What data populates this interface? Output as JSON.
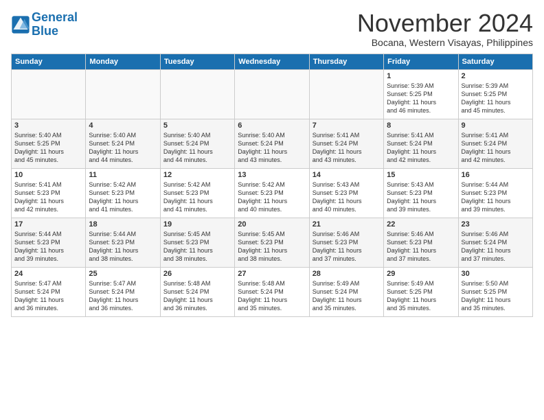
{
  "logo": {
    "text_general": "General",
    "text_blue": "Blue"
  },
  "title": "November 2024",
  "location": "Bocana, Western Visayas, Philippines",
  "weekdays": [
    "Sunday",
    "Monday",
    "Tuesday",
    "Wednesday",
    "Thursday",
    "Friday",
    "Saturday"
  ],
  "weeks": [
    [
      {
        "day": "",
        "info": ""
      },
      {
        "day": "",
        "info": ""
      },
      {
        "day": "",
        "info": ""
      },
      {
        "day": "",
        "info": ""
      },
      {
        "day": "",
        "info": ""
      },
      {
        "day": "1",
        "info": "Sunrise: 5:39 AM\nSunset: 5:25 PM\nDaylight: 11 hours\nand 46 minutes."
      },
      {
        "day": "2",
        "info": "Sunrise: 5:39 AM\nSunset: 5:25 PM\nDaylight: 11 hours\nand 45 minutes."
      }
    ],
    [
      {
        "day": "3",
        "info": "Sunrise: 5:40 AM\nSunset: 5:25 PM\nDaylight: 11 hours\nand 45 minutes."
      },
      {
        "day": "4",
        "info": "Sunrise: 5:40 AM\nSunset: 5:24 PM\nDaylight: 11 hours\nand 44 minutes."
      },
      {
        "day": "5",
        "info": "Sunrise: 5:40 AM\nSunset: 5:24 PM\nDaylight: 11 hours\nand 44 minutes."
      },
      {
        "day": "6",
        "info": "Sunrise: 5:40 AM\nSunset: 5:24 PM\nDaylight: 11 hours\nand 43 minutes."
      },
      {
        "day": "7",
        "info": "Sunrise: 5:41 AM\nSunset: 5:24 PM\nDaylight: 11 hours\nand 43 minutes."
      },
      {
        "day": "8",
        "info": "Sunrise: 5:41 AM\nSunset: 5:24 PM\nDaylight: 11 hours\nand 42 minutes."
      },
      {
        "day": "9",
        "info": "Sunrise: 5:41 AM\nSunset: 5:24 PM\nDaylight: 11 hours\nand 42 minutes."
      }
    ],
    [
      {
        "day": "10",
        "info": "Sunrise: 5:41 AM\nSunset: 5:23 PM\nDaylight: 11 hours\nand 42 minutes."
      },
      {
        "day": "11",
        "info": "Sunrise: 5:42 AM\nSunset: 5:23 PM\nDaylight: 11 hours\nand 41 minutes."
      },
      {
        "day": "12",
        "info": "Sunrise: 5:42 AM\nSunset: 5:23 PM\nDaylight: 11 hours\nand 41 minutes."
      },
      {
        "day": "13",
        "info": "Sunrise: 5:42 AM\nSunset: 5:23 PM\nDaylight: 11 hours\nand 40 minutes."
      },
      {
        "day": "14",
        "info": "Sunrise: 5:43 AM\nSunset: 5:23 PM\nDaylight: 11 hours\nand 40 minutes."
      },
      {
        "day": "15",
        "info": "Sunrise: 5:43 AM\nSunset: 5:23 PM\nDaylight: 11 hours\nand 39 minutes."
      },
      {
        "day": "16",
        "info": "Sunrise: 5:44 AM\nSunset: 5:23 PM\nDaylight: 11 hours\nand 39 minutes."
      }
    ],
    [
      {
        "day": "17",
        "info": "Sunrise: 5:44 AM\nSunset: 5:23 PM\nDaylight: 11 hours\nand 39 minutes."
      },
      {
        "day": "18",
        "info": "Sunrise: 5:44 AM\nSunset: 5:23 PM\nDaylight: 11 hours\nand 38 minutes."
      },
      {
        "day": "19",
        "info": "Sunrise: 5:45 AM\nSunset: 5:23 PM\nDaylight: 11 hours\nand 38 minutes."
      },
      {
        "day": "20",
        "info": "Sunrise: 5:45 AM\nSunset: 5:23 PM\nDaylight: 11 hours\nand 38 minutes."
      },
      {
        "day": "21",
        "info": "Sunrise: 5:46 AM\nSunset: 5:23 PM\nDaylight: 11 hours\nand 37 minutes."
      },
      {
        "day": "22",
        "info": "Sunrise: 5:46 AM\nSunset: 5:23 PM\nDaylight: 11 hours\nand 37 minutes."
      },
      {
        "day": "23",
        "info": "Sunrise: 5:46 AM\nSunset: 5:24 PM\nDaylight: 11 hours\nand 37 minutes."
      }
    ],
    [
      {
        "day": "24",
        "info": "Sunrise: 5:47 AM\nSunset: 5:24 PM\nDaylight: 11 hours\nand 36 minutes."
      },
      {
        "day": "25",
        "info": "Sunrise: 5:47 AM\nSunset: 5:24 PM\nDaylight: 11 hours\nand 36 minutes."
      },
      {
        "day": "26",
        "info": "Sunrise: 5:48 AM\nSunset: 5:24 PM\nDaylight: 11 hours\nand 36 minutes."
      },
      {
        "day": "27",
        "info": "Sunrise: 5:48 AM\nSunset: 5:24 PM\nDaylight: 11 hours\nand 35 minutes."
      },
      {
        "day": "28",
        "info": "Sunrise: 5:49 AM\nSunset: 5:24 PM\nDaylight: 11 hours\nand 35 minutes."
      },
      {
        "day": "29",
        "info": "Sunrise: 5:49 AM\nSunset: 5:25 PM\nDaylight: 11 hours\nand 35 minutes."
      },
      {
        "day": "30",
        "info": "Sunrise: 5:50 AM\nSunset: 5:25 PM\nDaylight: 11 hours\nand 35 minutes."
      }
    ]
  ]
}
